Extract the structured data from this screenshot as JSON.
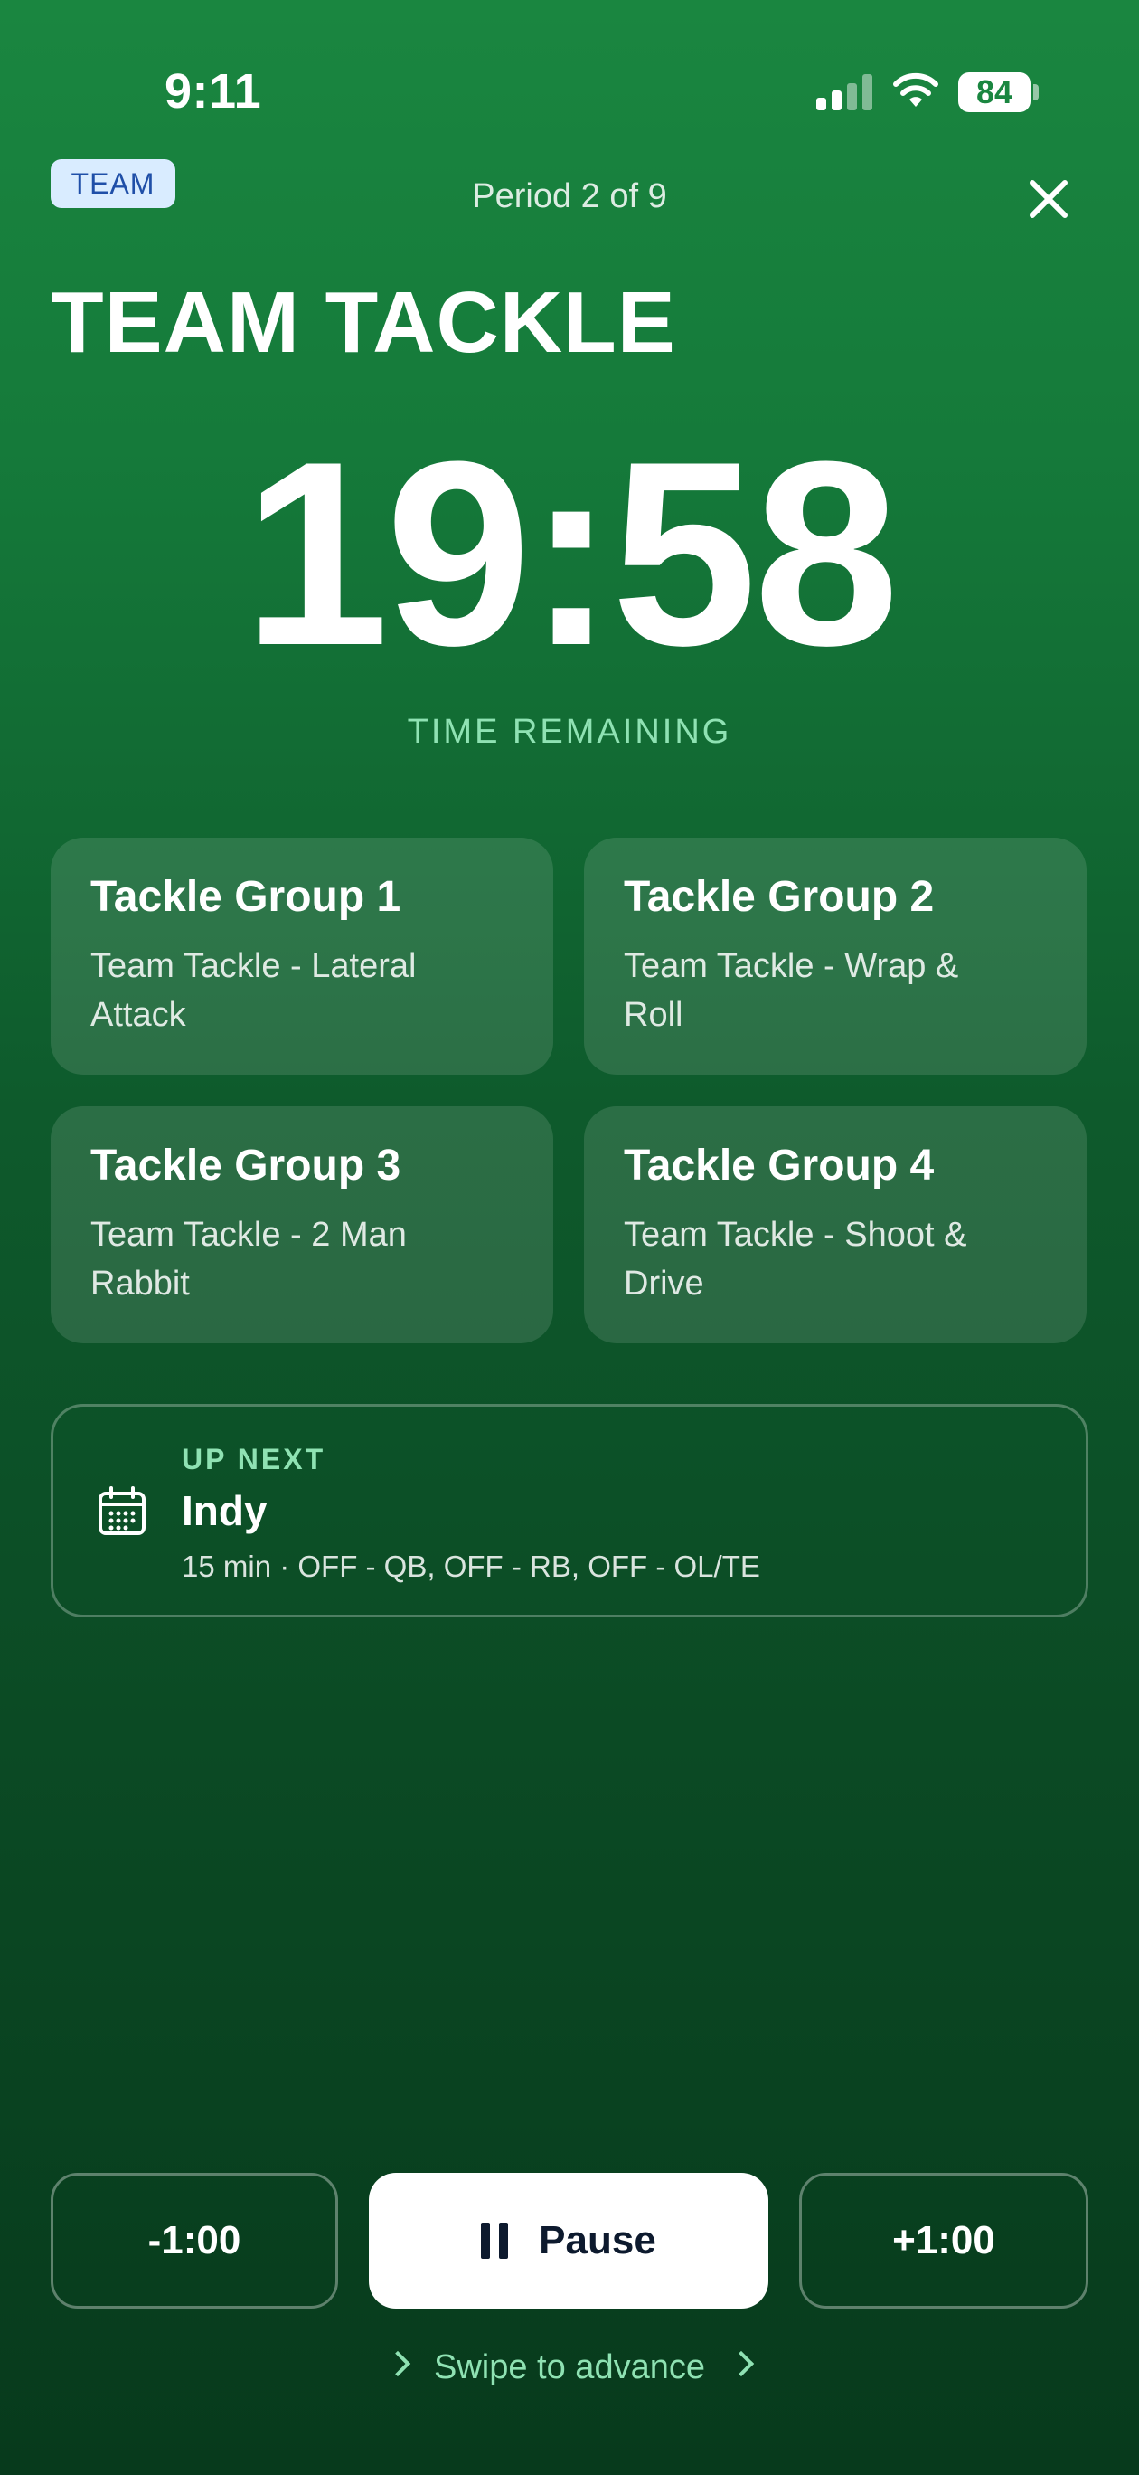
{
  "status_bar": {
    "time": "9:11",
    "battery": "84",
    "signal_bars_active": 2,
    "signal_bars_total": 4
  },
  "header": {
    "badge": "TEAM",
    "period": "Period 2 of 9",
    "close_icon": "close-icon"
  },
  "title": "TEAM TACKLE",
  "timer": {
    "value": "19:58",
    "label": "TIME REMAINING"
  },
  "groups": [
    {
      "name": "Tackle Group 1",
      "drill_line1": "Team Tackle - Lateral",
      "drill_line2": "Attack"
    },
    {
      "name": "Tackle Group 2",
      "drill_line1": "Team Tackle - Wrap &",
      "drill_line2": "Roll"
    },
    {
      "name": "Tackle Group 3",
      "drill_line1": "Team Tackle - 2 Man",
      "drill_line2": "Rabbit"
    },
    {
      "name": "Tackle Group 4",
      "drill_line1": "Team Tackle - Shoot &",
      "drill_line2": "Drive"
    }
  ],
  "up_next": {
    "label": "UP NEXT",
    "name": "Indy",
    "meta": "15 min · OFF - QB, OFF - RB, OFF - OL/TE",
    "icon": "calendar-icon"
  },
  "controls": {
    "minus": "-1:00",
    "pause": "Pause",
    "plus": "+1:00"
  },
  "swipe_hint": "Swipe to advance",
  "colors": {
    "accent_text": "#8fe2b3",
    "background_top": "#1a8640",
    "background_bottom": "#073a1c",
    "badge_bg": "#d9ecff",
    "badge_text": "#1f4fa8"
  }
}
